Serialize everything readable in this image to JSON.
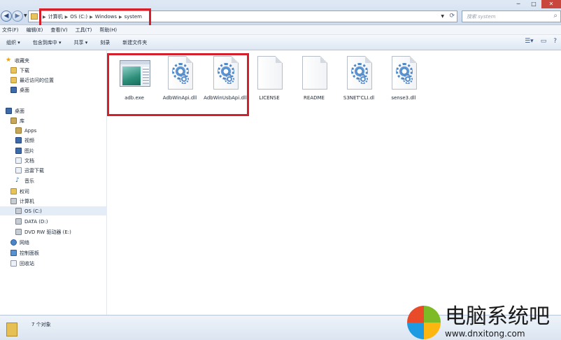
{
  "window": {
    "minimize": "─",
    "maximize": "□",
    "close": "✕"
  },
  "address": {
    "crumbs": [
      "计算机",
      "OS (C:)",
      "Windows",
      "system"
    ],
    "separator": "▶"
  },
  "search": {
    "placeholder": "搜索 system"
  },
  "menu": [
    "文件(F)",
    "编辑(E)",
    "查看(V)",
    "工具(T)",
    "帮助(H)"
  ],
  "commands": [
    "组织 ▾",
    "包含到库中 ▾",
    "共享 ▾",
    "刻录",
    "新建文件夹"
  ],
  "sidebar": {
    "favorites": "收藏夹",
    "favorites_items": [
      "下载",
      "最近访问的位置",
      "桌面"
    ],
    "desktop": "桌面",
    "libraries": "库",
    "library_items": [
      "Apps",
      "视频",
      "图片",
      "文档",
      "迅雷下载",
      "音乐"
    ],
    "user": "权司",
    "computer": "计算机",
    "drives": [
      "OS (C:)",
      "DATA (D:)",
      "DVD RW 驱动器 (E:)"
    ],
    "network": "网络",
    "control_panel": "控制面板",
    "recycle_bin": "回收站"
  },
  "files": [
    {
      "name": "adb.exe",
      "type": "exe"
    },
    {
      "name": "AdbWinApi.dll",
      "type": "dll"
    },
    {
      "name": "AdbWinUsbApi.dll",
      "type": "dll"
    },
    {
      "name": "LICENSE",
      "type": "doc"
    },
    {
      "name": "README",
      "type": "doc"
    },
    {
      "name": "S3NET'CLI.dl",
      "type": "dll"
    },
    {
      "name": "sense3.dll",
      "type": "dll"
    }
  ],
  "status": {
    "count": "7 个对象"
  },
  "watermark": {
    "title": "电脑系统吧",
    "url": "www.dnxitong.com"
  },
  "colors": {
    "highlight": "#d3202a",
    "logo_red": "#e94a2a",
    "logo_green": "#7cbb26",
    "logo_blue": "#1d9ae2",
    "logo_yellow": "#fbb70f"
  }
}
